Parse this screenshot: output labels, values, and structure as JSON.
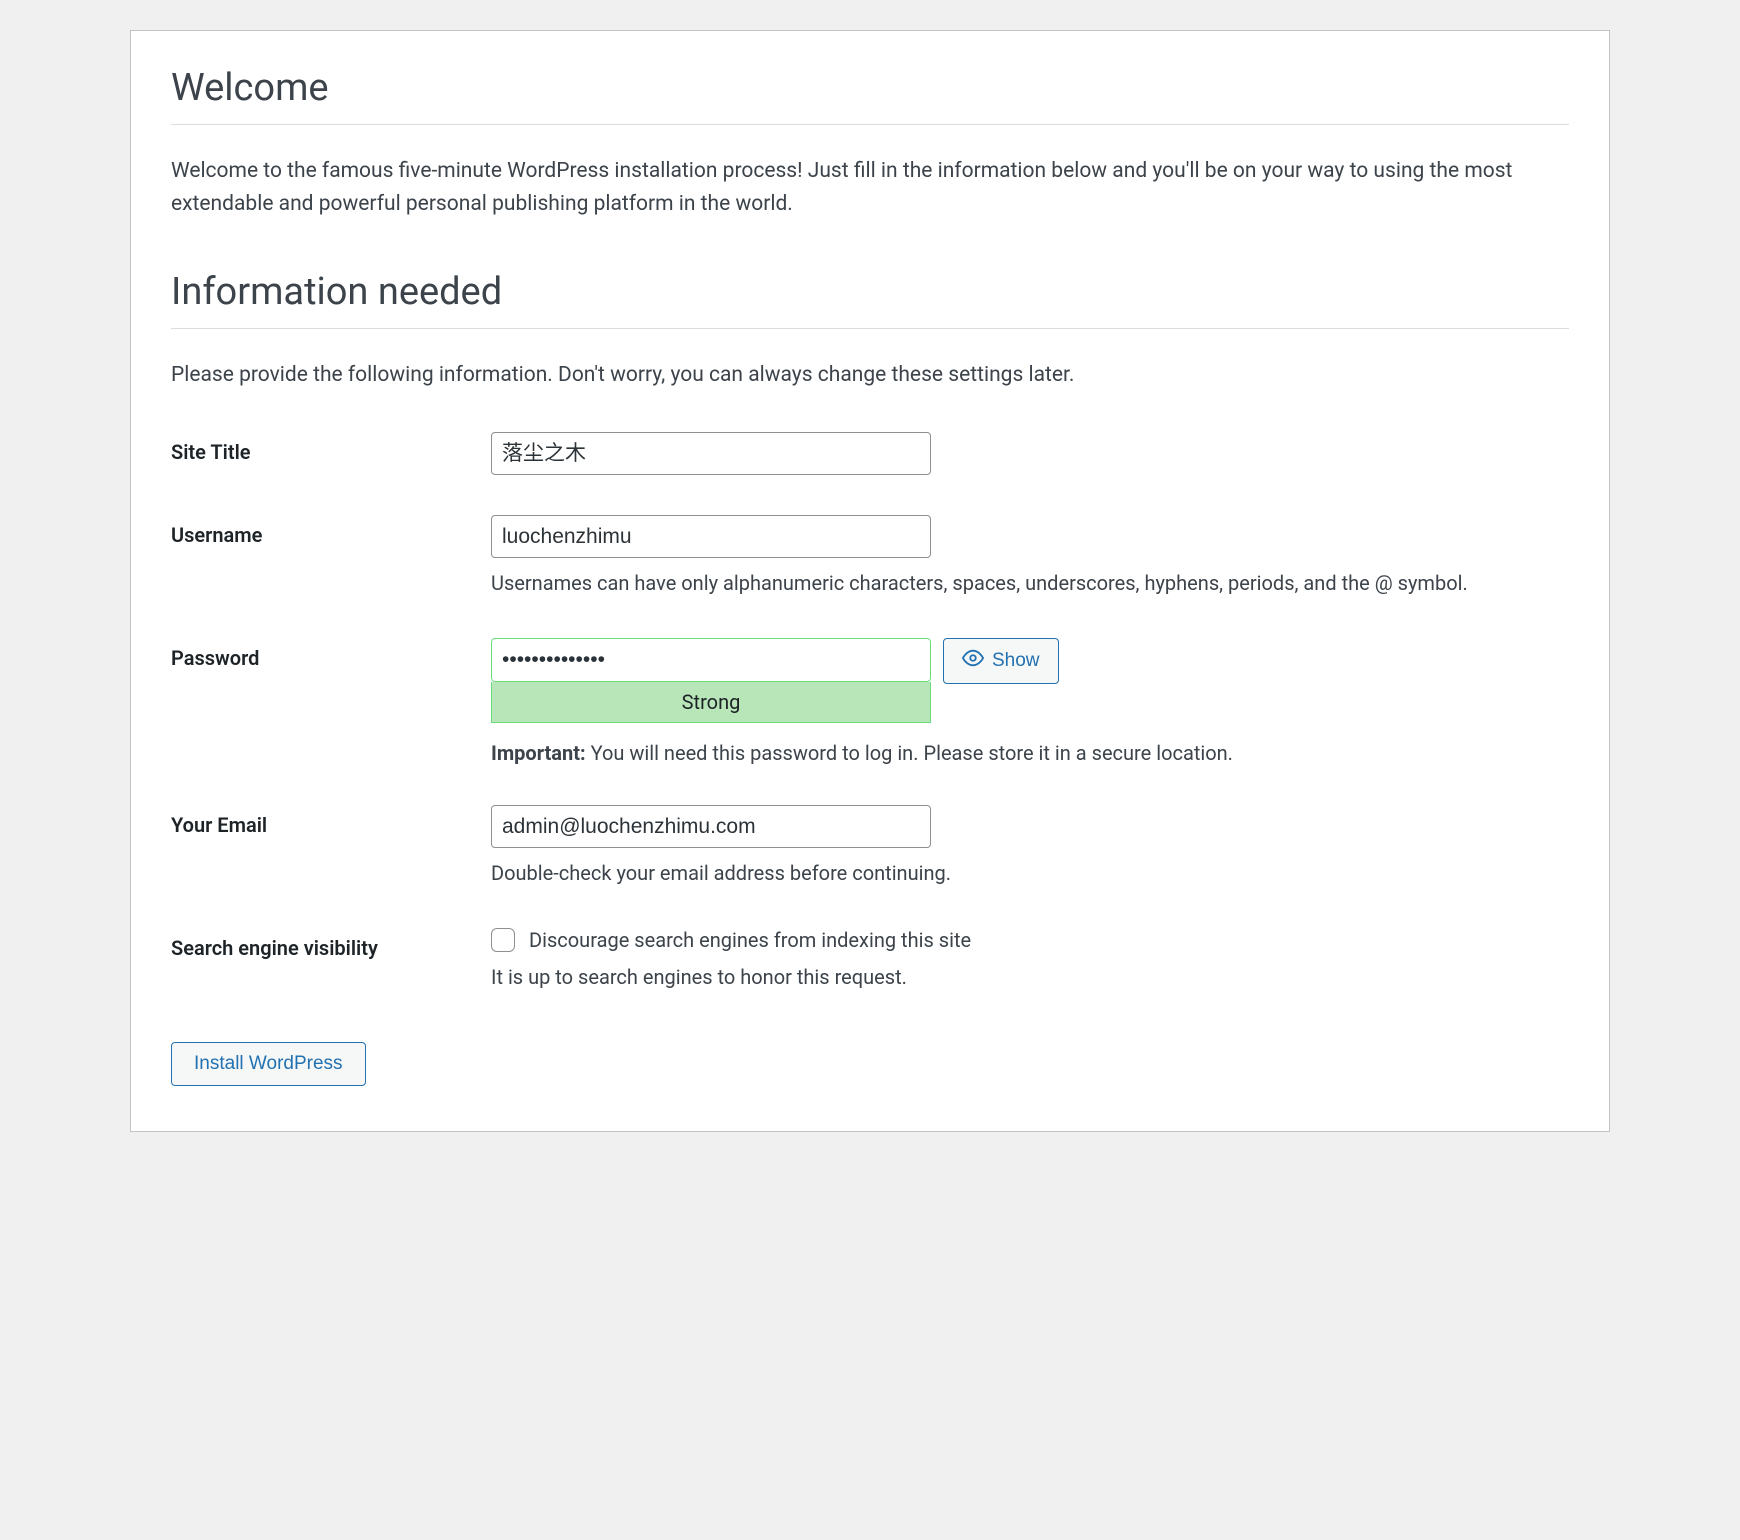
{
  "headings": {
    "welcome": "Welcome",
    "info_needed": "Information needed"
  },
  "intro": "Welcome to the famous five-minute WordPress installation process! Just fill in the information below and you'll be on your way to using the most extendable and powerful personal publishing platform in the world.",
  "sub": "Please provide the following information. Don't worry, you can always change these settings later.",
  "fields": {
    "site_title": {
      "label": "Site Title",
      "value": "落尘之木"
    },
    "username": {
      "label": "Username",
      "value": "luochenzhimu",
      "description": "Usernames can have only alphanumeric characters, spaces, underscores, hyphens, periods, and the @ symbol."
    },
    "password": {
      "label": "Password",
      "value": "••••••••••••••",
      "strength": "Strong",
      "show_button": "Show",
      "important_label": "Important:",
      "important_text": " You will need this password to log in. Please store it in a secure location."
    },
    "email": {
      "label": "Your Email",
      "value": "admin@luochenzhimu.com",
      "description": "Double-check your email address before continuing."
    },
    "search_visibility": {
      "label": "Search engine visibility",
      "checkbox_label": "Discourage search engines from indexing this site",
      "checked": false,
      "description": "It is up to search engines to honor this request."
    }
  },
  "submit": "Install WordPress"
}
